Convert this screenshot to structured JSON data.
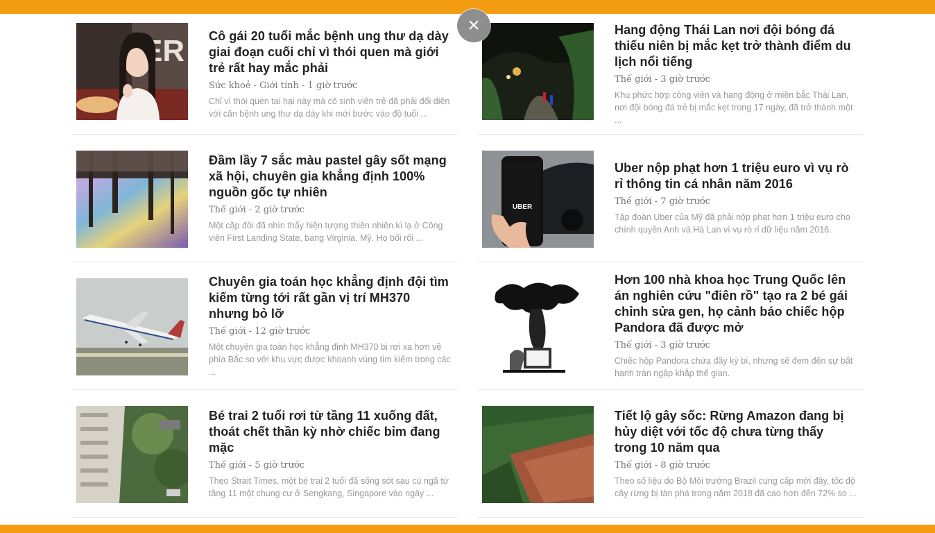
{
  "colors": {
    "accent": "#f39c12"
  },
  "close_icon": "×",
  "left_articles": [
    {
      "title": "Cô gái 20 tuổi mắc bệnh ung thư dạ dày giai đoạn cuối chỉ vì thói quen mà giới trẻ rất hay mắc phải",
      "meta": "Sức khoẻ - Giới tính - 1 giờ trước",
      "excerpt": "Chỉ vì thói quen tai hại này mà cô sinh viên trẻ đã phải đối diện với căn bệnh ung thư dạ dày khi mới bước vào độ tuổi ..."
    },
    {
      "title": "Đầm lầy 7 sắc màu pastel gây sốt mạng xã hội, chuyên gia khẳng định 100% nguồn gốc tự nhiên",
      "meta": "Thế giới - 2 giờ trước",
      "excerpt": "Một cặp đôi đã nhìn thấy hiện tượng thiên nhiên kì lạ ở Công viên First Landing State, bang Virginia, Mỹ. Họ bối rối ..."
    },
    {
      "title": "Chuyên gia toán học khẳng định đội tìm kiếm từng tới rất gần vị trí MH370 nhưng bỏ lỡ",
      "meta": "Thế giới - 12 giờ trước",
      "excerpt": "Một chuyên gia toán học khẳng định MH370 bị rơi xa hơn về phía Bắc so với khu vực được khoanh vùng tìm kiếm trong các ..."
    },
    {
      "title": "Bé trai 2 tuổi rơi từ tầng 11 xuống đất, thoát chết thần kỳ nhờ chiếc bỉm đang mặc",
      "meta": "Thế giới - 5 giờ trước",
      "excerpt": "Theo Strait Times, một bé trai 2 tuổi đã sống sót sau cú ngã từ tầng 11 một chung cư ở Sengkang, Singapore vào ngày ..."
    }
  ],
  "right_articles": [
    {
      "title": "Hang động Thái Lan nơi đội bóng đá thiếu niên bị mắc kẹt trở thành điểm du lịch nổi tiếng",
      "meta": "Thế giới - 3 giờ trước",
      "excerpt": "Khu phức hợp công viên và hang động ở miền bắc Thái Lan, nơi đội bóng đá trẻ bị mắc kẹt trong 17 ngày, đã trở thành một ..."
    },
    {
      "title": "Uber nộp phạt hơn 1 triệu euro vì vụ rò rỉ thông tin cá nhân năm 2016",
      "meta": "Thế giới - 7 giờ trước",
      "excerpt": "Tập đoàn Uber của Mỹ đã phải nộp phạt hơn 1 triệu euro cho chính quyền Anh và Hà Lan vì vụ rò rỉ dữ liệu năm 2016."
    },
    {
      "title": "Hơn 100 nhà khoa học Trung Quốc lên án nghiên cứu \"điên rồ\" tạo ra 2 bé gái chỉnh sửa gen, họ cảnh báo chiếc hộp Pandora đã được mở",
      "meta": "Thế giới - 3 giờ trước",
      "excerpt": "Chiếc hộp Pandora chứa đầy kỳ bí, nhưng sẽ đem đến sự bất hạnh tràn ngập khắp thế gian."
    },
    {
      "title": "Tiết lộ gây sốc: Rừng Amazon đang bị hủy diệt với tốc độ chưa từng thấy trong 10 năm qua",
      "meta": "Thế giới - 8 giờ trước",
      "excerpt": "Theo số liệu do Bộ Môi trường Brazil cung cấp mới đây, tốc độ cây rừng bị tàn phá trong năm 2018 đã cao hơn đến 72% so ..."
    }
  ],
  "thumbs": {
    "girl": "ER",
    "uber": "UBER"
  }
}
